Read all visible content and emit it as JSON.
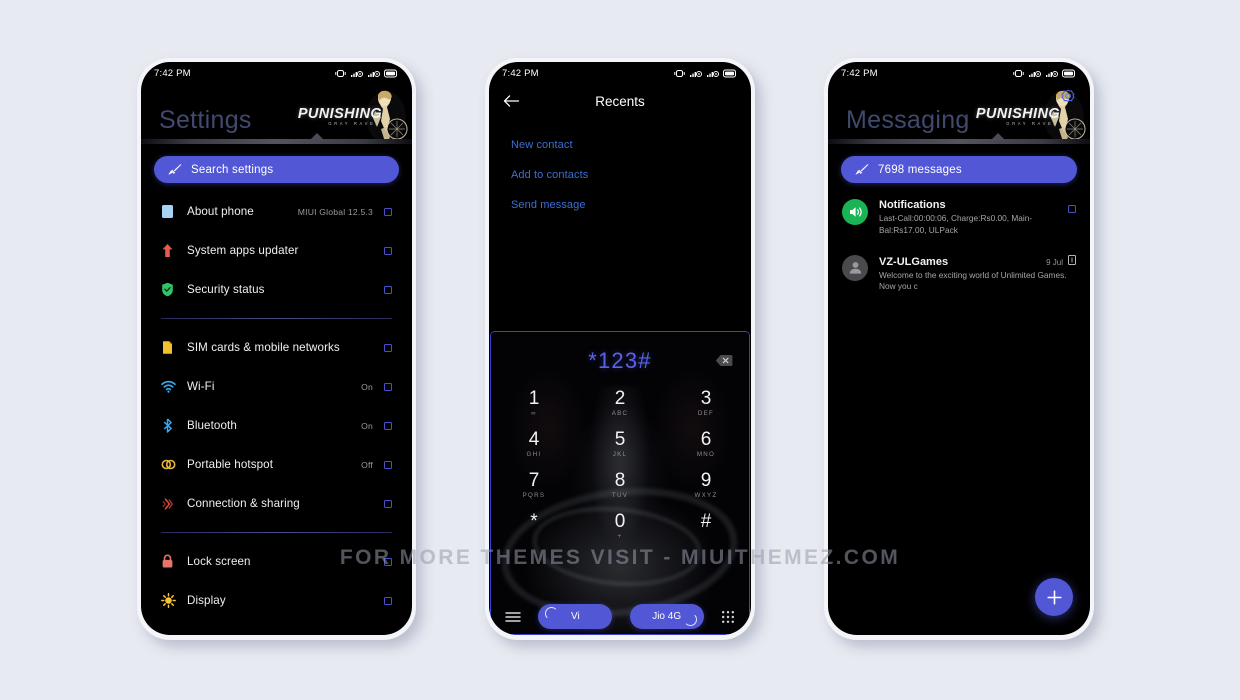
{
  "watermark": "FOR MORE THEMES VISIT - MIUITHEMEZ.COM",
  "theme": {
    "accent_blue": "#5257d6",
    "link_blue": "#3b6fd4",
    "screen_bg": "#000000",
    "page_bg": "#e8eaf2",
    "dial_number_color": "#5a62e8",
    "arrow_outline": "#4a4fcf"
  },
  "status_bar": {
    "time": "7:42 PM"
  },
  "brand": {
    "wordmark": "PUNISHING",
    "subword": "GRAY RAVEN"
  },
  "settings": {
    "title": "Settings",
    "search": {
      "placeholder": "Search settings",
      "icon": "sword-icon"
    },
    "groups": [
      {
        "items": [
          {
            "label": "About phone",
            "value": "MIUI Global 12.5.3",
            "icon": "about-phone-icon"
          },
          {
            "label": "System apps updater",
            "value": "",
            "icon": "updater-arrow-icon"
          },
          {
            "label": "Security status",
            "value": "",
            "icon": "shield-check-icon"
          }
        ]
      },
      {
        "items": [
          {
            "label": "SIM cards & mobile networks",
            "value": "",
            "icon": "sim-card-icon"
          },
          {
            "label": "Wi-Fi",
            "value": "On",
            "icon": "wifi-icon"
          },
          {
            "label": "Bluetooth",
            "value": "On",
            "icon": "bluetooth-icon"
          },
          {
            "label": "Portable hotspot",
            "value": "Off",
            "icon": "hotspot-icon"
          },
          {
            "label": "Connection & sharing",
            "value": "",
            "icon": "connection-sharing-icon"
          }
        ]
      },
      {
        "items": [
          {
            "label": "Lock screen",
            "value": "",
            "icon": "lock-icon"
          },
          {
            "label": "Display",
            "value": "",
            "icon": "brightness-icon"
          }
        ]
      }
    ]
  },
  "dialer": {
    "title": "Recents",
    "back_icon": "back-arrow-icon",
    "actions": [
      "New contact",
      "Add to contacts",
      "Send message"
    ],
    "number": "*123#",
    "backspace_icon": "backspace-icon",
    "keys": [
      {
        "digit": "1",
        "sub": "∞"
      },
      {
        "digit": "2",
        "sub": "ABC"
      },
      {
        "digit": "3",
        "sub": "DEF"
      },
      {
        "digit": "4",
        "sub": "GHI"
      },
      {
        "digit": "5",
        "sub": "JKL"
      },
      {
        "digit": "6",
        "sub": "MNO"
      },
      {
        "digit": "7",
        "sub": "PQRS"
      },
      {
        "digit": "8",
        "sub": "TUV"
      },
      {
        "digit": "9",
        "sub": "WXYZ"
      },
      {
        "digit": "*",
        "sub": ""
      },
      {
        "digit": "0",
        "sub": "+"
      },
      {
        "digit": "#",
        "sub": ""
      }
    ],
    "bottom_bar": {
      "menu_icon": "hamburger-menu-icon",
      "sim1_label": "Vi",
      "sim2_label": "Jio 4G",
      "keypad_icon": "dialpad-grid-icon"
    }
  },
  "messaging": {
    "title": "Messaging",
    "gear_icon": "settings-gear-icon",
    "search": {
      "placeholder": "7698 messages",
      "icon": "sword-icon"
    },
    "threads": [
      {
        "name": "Notifications",
        "date": "",
        "preview": "Last-Call:00:00:06, Charge:Rs0.00, Main-Bal:Rs17.00, ULPack",
        "avatar": "speaker-icon",
        "avatar_color": "green",
        "has_arrow": true
      },
      {
        "name": "VZ-ULGames",
        "date": "9 Jul",
        "preview": "Welcome to the exciting world of Unlimited Games. Now you c",
        "avatar": "person-icon",
        "avatar_color": "grey",
        "has_arrow": false
      }
    ],
    "fab_icon": "plus-icon"
  }
}
